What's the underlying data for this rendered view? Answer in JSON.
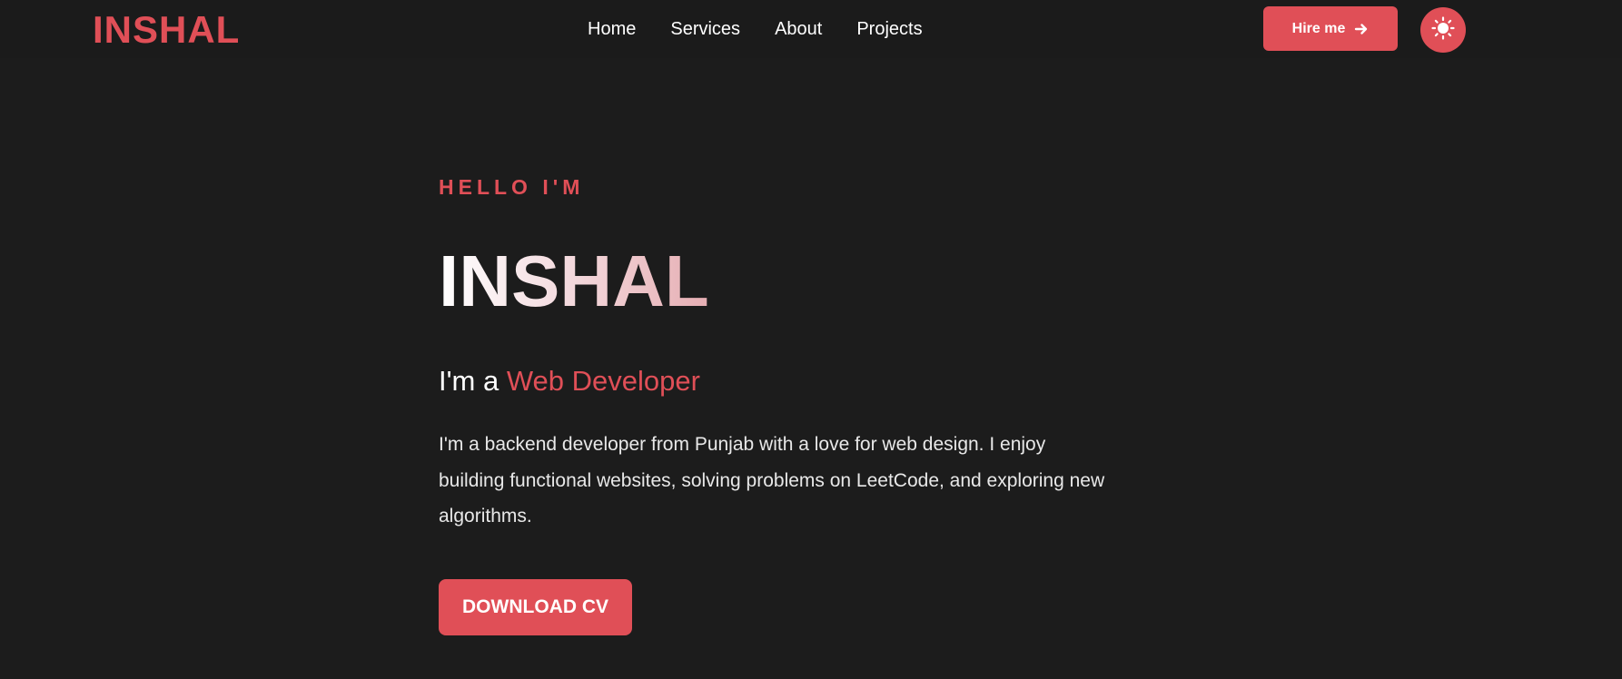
{
  "navbar": {
    "logo": "INSHAL",
    "links": [
      "Home",
      "Services",
      "About",
      "Projects"
    ],
    "hire_label": "Hire me",
    "hire_icon": "arrow-right-icon",
    "theme_icon": "sun-icon"
  },
  "hero": {
    "greeting": "HELLO I'M",
    "name": "INSHAL",
    "role_prefix": "I'm a",
    "role": "Web Developer",
    "bio": "I'm a backend developer from Punjab with a love for web design. I enjoy building functional websites, solving problems on LeetCode, and exploring new algorithms.",
    "cta_label": "DOWNLOAD CV"
  },
  "colors": {
    "background": "#1c1c1c",
    "accent": "#e04f57",
    "text": "#ffffff"
  }
}
